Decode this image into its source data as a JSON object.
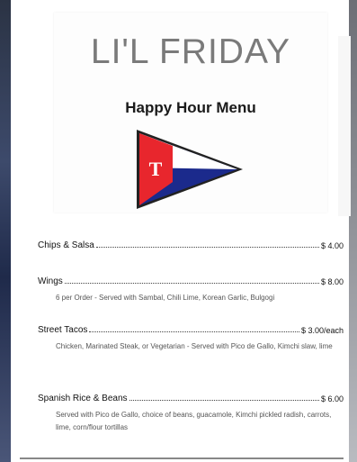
{
  "header": {
    "brand": "LI'L FRIDAY",
    "subtitle": "Happy Hour Menu",
    "burgee_letter": "T"
  },
  "colors": {
    "burgee_red": "#e8262d",
    "burgee_blue": "#1b2a8c",
    "burgee_white": "#ffffff",
    "title_gray": "#7a7a7a"
  },
  "items": [
    {
      "name": "Chips & Salsa",
      "price": "$ 4.00",
      "description": ""
    },
    {
      "name": "Wings",
      "price": "$ 8.00",
      "description": "6 per Order - Served with Sambal, Chili Lime, Korean Garlic, Bulgogi"
    },
    {
      "name": "Street Tacos",
      "price": "$ 3.00/each",
      "description": "Chicken, Marinated Steak, or Vegetarian - Served with Pico de Gallo, Kimchi slaw, lime"
    },
    {
      "name": "Spanish Rice & Beans",
      "price": "$ 6.00",
      "description": "Served with Pico de Gallo, choice of beans, guacamole, Kimchi pickled radish, carrots, lime, corn/flour tortillas"
    }
  ]
}
